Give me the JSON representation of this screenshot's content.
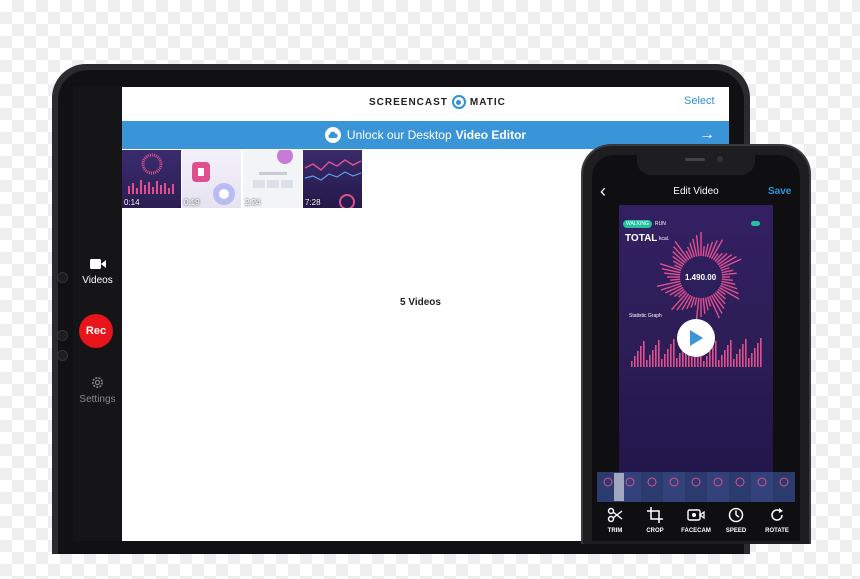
{
  "colors": {
    "accent": "#2d93d6",
    "banner": "#3a95d8",
    "record": "#e8151b",
    "chart_pink": "#e0508f"
  },
  "sidebar": {
    "videos_label": "Videos",
    "rec_label": "Rec",
    "settings_label": "Settings"
  },
  "header": {
    "brand_left": "SCREENCAST",
    "brand_right": "MATIC",
    "select_label": "Select"
  },
  "banner": {
    "text_regular": "Unlock our Desktop",
    "text_bold": "Video Editor",
    "arrow": "→"
  },
  "thumbnails": [
    {
      "duration": "0:14"
    },
    {
      "duration": "0:19"
    },
    {
      "duration": "2:24"
    },
    {
      "duration": "7:28"
    }
  ],
  "library": {
    "count_label": "5 Videos"
  },
  "phone": {
    "back": "‹",
    "title": "Edit Video",
    "save_label": "Save",
    "video": {
      "tab_walking": "WALKING",
      "tab_run": "RUN",
      "total": "TOTAL",
      "unit": "kcal.",
      "value": "1.490.00",
      "graph_title": "Statistic Graph"
    },
    "tools": [
      {
        "label": "TRIM",
        "icon": "scissors-icon"
      },
      {
        "label": "CROP",
        "icon": "crop-icon"
      },
      {
        "label": "FACECAM",
        "icon": "facecam-icon"
      },
      {
        "label": "SPEED",
        "icon": "speed-icon"
      },
      {
        "label": "ROTATE",
        "icon": "rotate-icon"
      }
    ]
  }
}
